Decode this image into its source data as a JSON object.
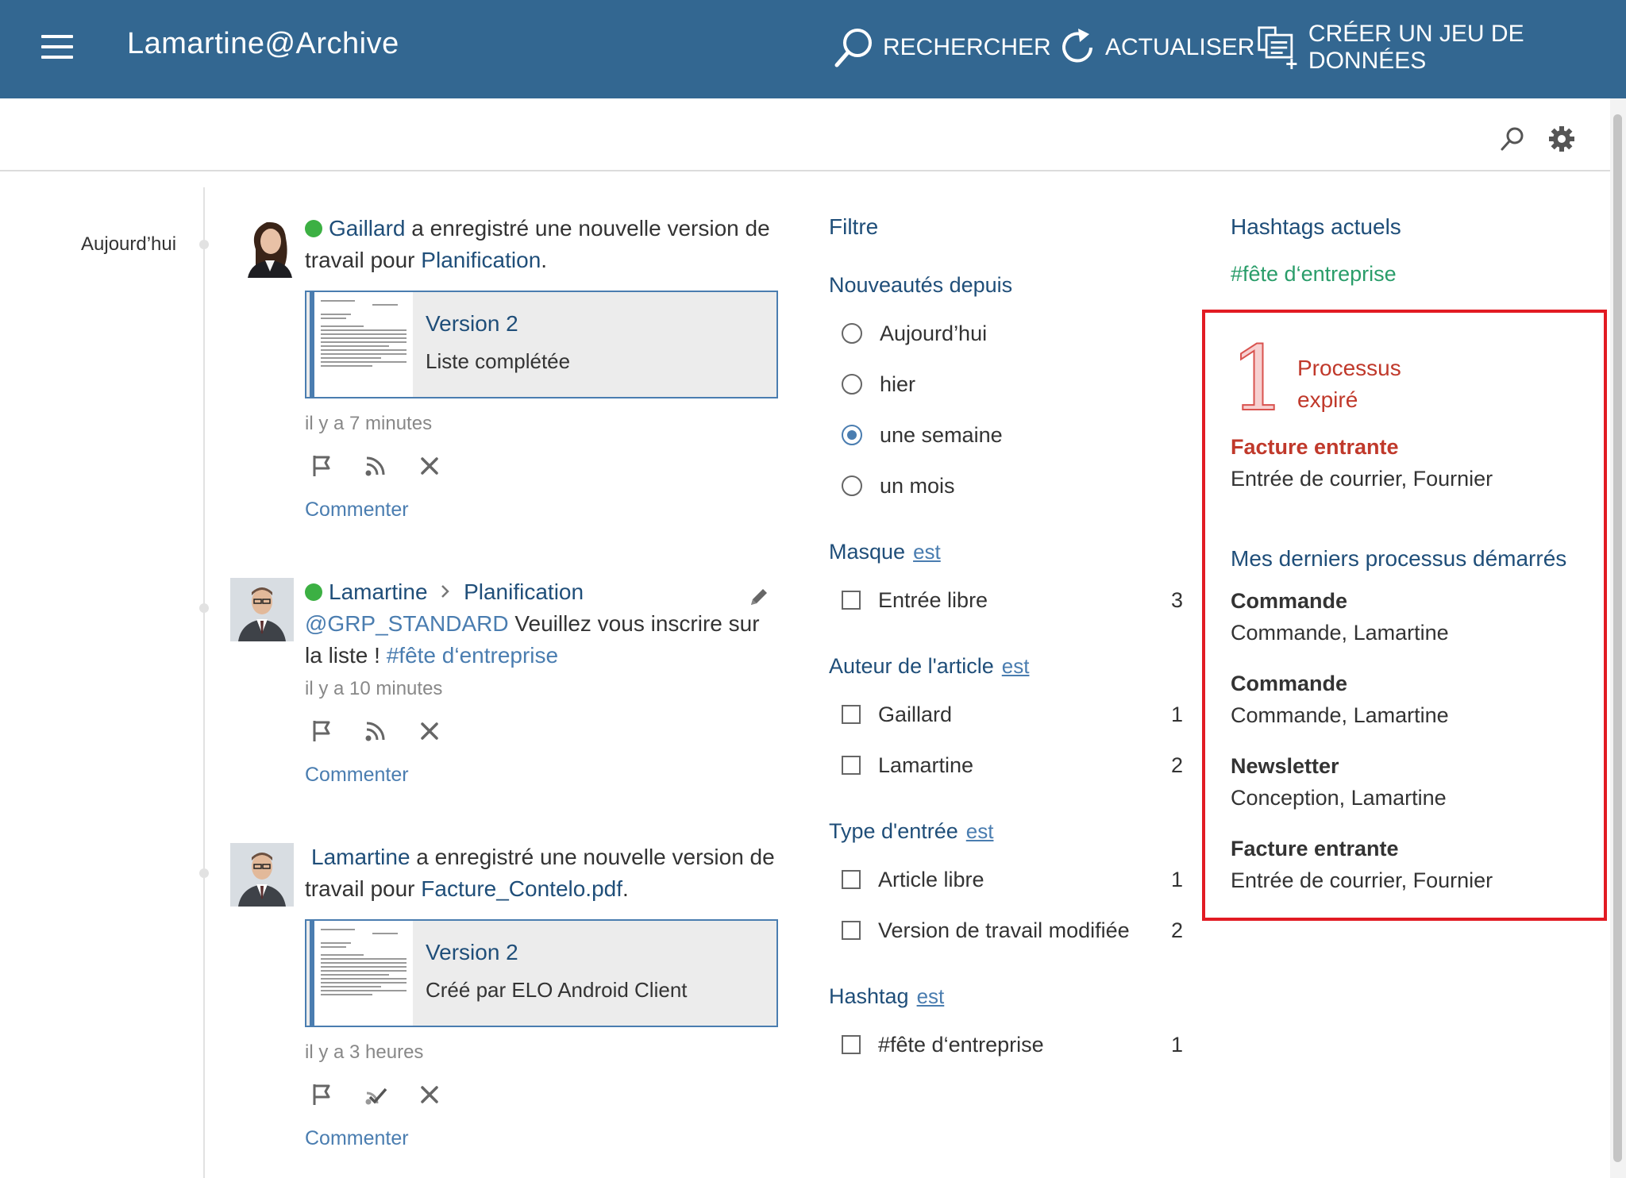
{
  "header": {
    "title": "Lamartine@Archive",
    "search_label": "RECHERCHER",
    "refresh_label": "ACTUALISER",
    "create_label": "CRÉER UN JEU DE DONNÉES"
  },
  "timeline": {
    "date_label": "Aujourd’hui"
  },
  "feed": [
    {
      "author": "Gaillard",
      "text_before": "a enregistré une nouvelle version de travail pour",
      "target": "Planification",
      "text_after": ".",
      "version_title": "Version 2",
      "version_sub": "Liste complétée",
      "time": "il y a 7 minutes",
      "comment": "Commenter"
    },
    {
      "author": "Lamartine",
      "target": "Planification",
      "mention": "@GRP_STANDARD",
      "text": "Veuillez vous inscrire sur la liste !",
      "hashtag": "#fête d‘entreprise",
      "time": "il y a 10 minutes",
      "comment": "Commenter"
    },
    {
      "author": "Lamartine",
      "text_before": "a enregistré une nouvelle version de travail pour",
      "target": "Facture_Contelo.pdf",
      "text_after": ".",
      "version_title": "Version 2",
      "version_sub": "Créé par ELO Android Client",
      "time": "il y a 3 heures",
      "comment": "Commenter"
    }
  ],
  "filter": {
    "title": "Filtre",
    "since_heading": "Nouveautés depuis",
    "since_options": [
      "Aujourd’hui",
      "hier",
      "une semaine",
      "un mois"
    ],
    "since_selected": "une semaine",
    "est": "est",
    "masque": {
      "heading": "Masque",
      "items": [
        {
          "label": "Entrée libre",
          "count": "3"
        }
      ]
    },
    "auteur": {
      "heading": "Auteur de l'article",
      "items": [
        {
          "label": "Gaillard",
          "count": "1"
        },
        {
          "label": "Lamartine",
          "count": "2"
        }
      ]
    },
    "type": {
      "heading": "Type d'entrée",
      "items": [
        {
          "label": "Article libre",
          "count": "1"
        },
        {
          "label": "Version de travail modifiée",
          "count": "2"
        }
      ]
    },
    "hashtag": {
      "heading": "Hashtag",
      "items": [
        {
          "label": "#fête d‘entreprise",
          "count": "1"
        }
      ]
    }
  },
  "right": {
    "hashtags_heading": "Hashtags actuels",
    "hashtag": "#fête d‘entreprise",
    "expired_count": "1",
    "expired_line1": "Processus",
    "expired_line2": "expiré",
    "expired_title": "Facture entrante",
    "expired_sub": "Entrée de courrier, Fournier",
    "recent_heading": "Mes derniers processus démarrés",
    "recent": [
      {
        "title": "Commande",
        "sub": "Commande, Lamartine"
      },
      {
        "title": "Commande",
        "sub": "Commande, Lamartine"
      },
      {
        "title": "Newsletter",
        "sub": "Conception, Lamartine"
      },
      {
        "title": "Facture entrante",
        "sub": "Entrée de courrier, Fournier"
      }
    ]
  },
  "colors": {
    "header": "#336791",
    "link": "#1f4e79",
    "hashtag": "#2a9d6a",
    "alert": "#e21b23",
    "online": "#3cb043"
  }
}
